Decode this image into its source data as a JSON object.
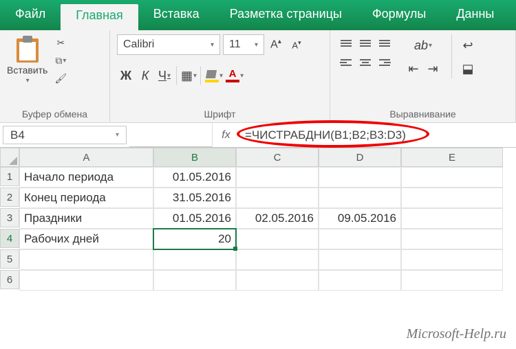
{
  "tabs": {
    "file": "Файл",
    "home": "Главная",
    "insert": "Вставка",
    "layout": "Разметка страницы",
    "formulas": "Формулы",
    "data": "Данны"
  },
  "ribbon": {
    "clipboard": {
      "paste": "Вставить",
      "label": "Буфер обмена"
    },
    "font": {
      "name": "Calibri",
      "size": "11",
      "bold": "Ж",
      "italic": "К",
      "underline": "Ч",
      "label": "Шрифт"
    },
    "align": {
      "label": "Выравнивание"
    }
  },
  "namebox": "B4",
  "fx": "fx",
  "formula": "=ЧИСТРАБДНИ(B1;B2;B3:D3)",
  "columns": [
    "A",
    "B",
    "C",
    "D",
    "E"
  ],
  "rows": [
    {
      "n": "1",
      "A": "Начало периода",
      "B": "01.05.2016",
      "C": "",
      "D": "",
      "E": ""
    },
    {
      "n": "2",
      "A": "Конец периода",
      "B": "31.05.2016",
      "C": "",
      "D": "",
      "E": ""
    },
    {
      "n": "3",
      "A": "Праздники",
      "B": "01.05.2016",
      "C": "02.05.2016",
      "D": "09.05.2016",
      "E": ""
    },
    {
      "n": "4",
      "A": "Рабочих дней",
      "B": "20",
      "C": "",
      "D": "",
      "E": ""
    },
    {
      "n": "5",
      "A": "",
      "B": "",
      "C": "",
      "D": "",
      "E": ""
    },
    {
      "n": "6",
      "A": "",
      "B": "",
      "C": "",
      "D": "",
      "E": ""
    }
  ],
  "selected": {
    "row": 3,
    "col": "B"
  },
  "watermark": "Microsoft-Help.ru"
}
